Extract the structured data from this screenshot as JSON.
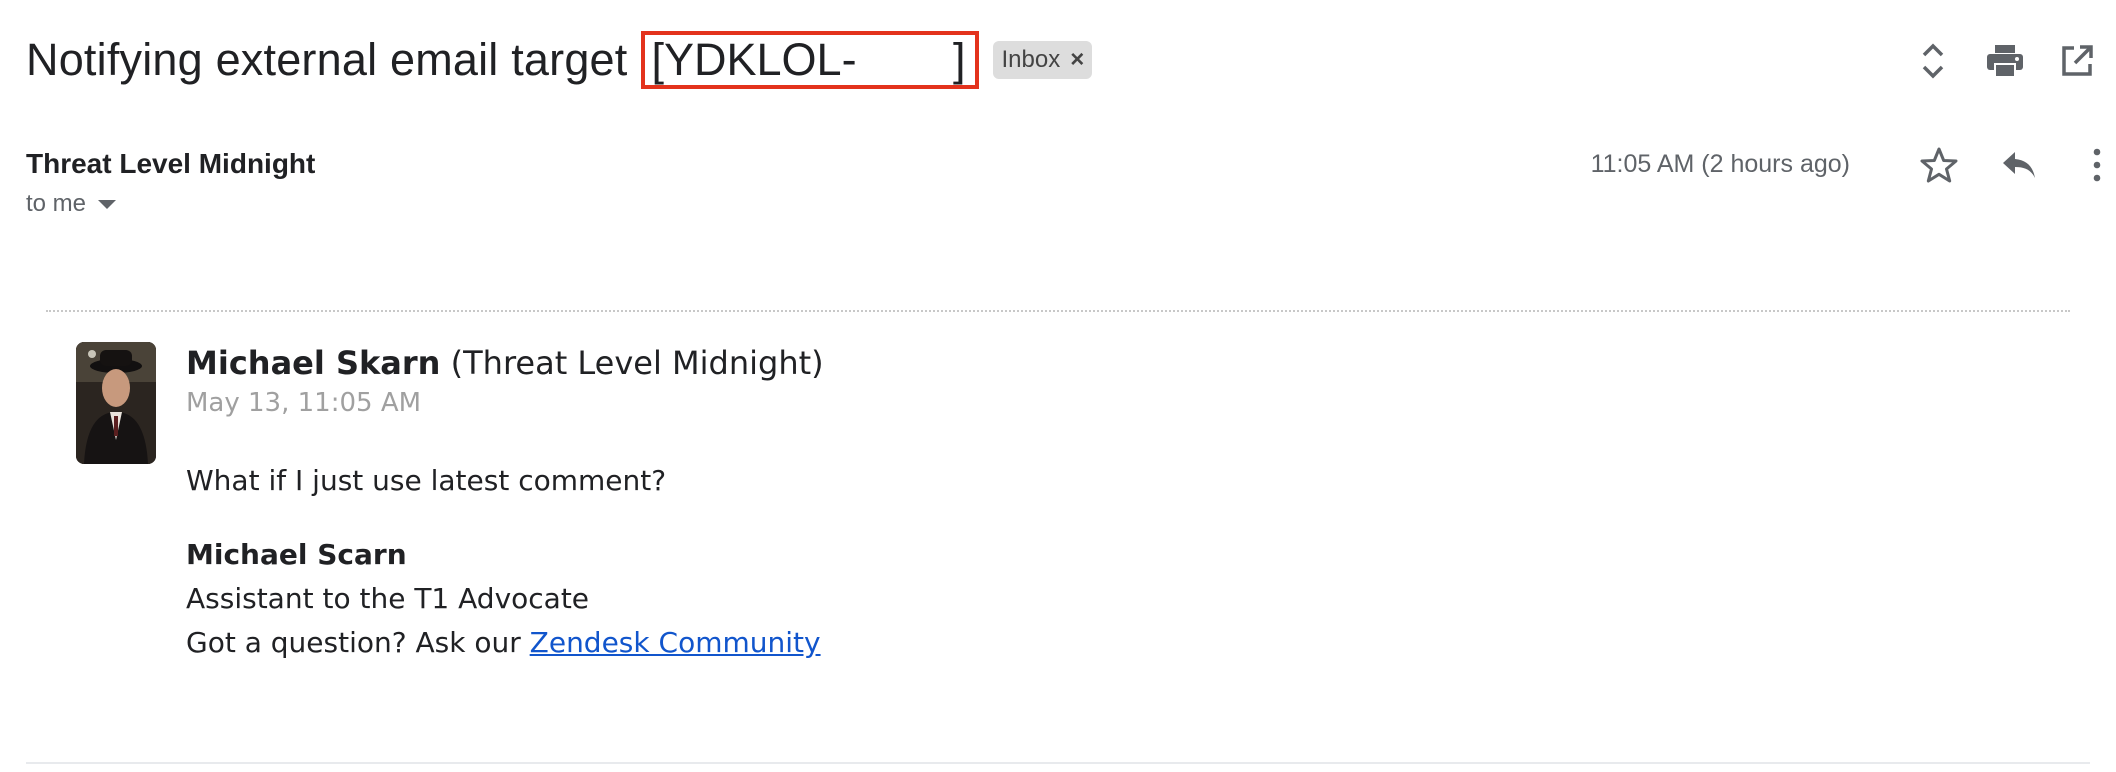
{
  "email": {
    "subject": "Notifying external email target",
    "ticket_tag": "[YDKLOL-",
    "ticket_tag_end": "]",
    "label": "Inbox",
    "label_close": "×",
    "sender": "Threat Level Midnight",
    "recipient": "to me",
    "timestamp": "11:05 AM (2 hours ago)"
  },
  "quoted": {
    "author_name": "Michael Skarn",
    "author_org": "(Threat Level Midnight)",
    "date": "May 13, 11:05 AM",
    "message": "What if I just use latest comment?",
    "signature_name": "Michael Scarn",
    "signature_title": "Assistant to the T1 Advocate",
    "help_prefix": "Got a question? Ask our ",
    "help_link": "Zendesk Community"
  },
  "icons": {
    "expand": "unfold-icon",
    "print": "print-icon",
    "open_new": "open-in-new-window-icon",
    "star": "star-icon",
    "reply": "reply-icon",
    "more": "more-vertical-icon"
  },
  "colors": {
    "highlight_border": "#e3321c",
    "link": "#1155cc",
    "chip_bg": "#dddddd"
  }
}
